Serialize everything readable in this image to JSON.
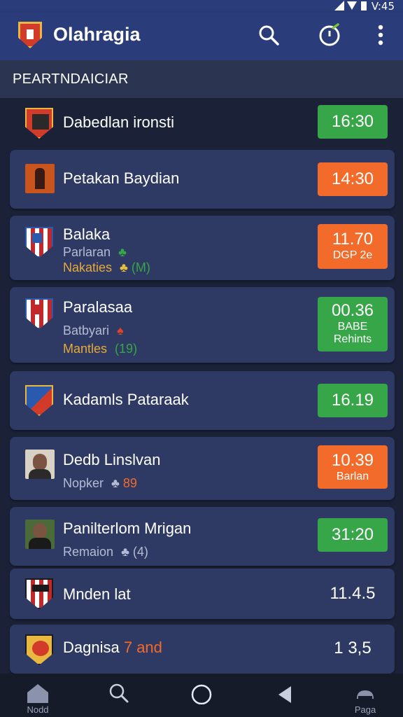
{
  "status_bar": {
    "time": "V:45"
  },
  "header": {
    "title": "Olahragia"
  },
  "section": {
    "title": "PEARTNDAICIAR"
  },
  "matches": [
    {
      "name": "Dabedlan ironsti",
      "score": "16:30",
      "score_color": "#36a648"
    },
    {
      "name": "Petakan Baydian",
      "score": "14:30",
      "score_color": "#f26b2a"
    },
    {
      "name": "Balaka",
      "sub": "Parlaran",
      "sub2": "Nakaties",
      "sub2_tag": "(M)",
      "score": "11.70",
      "score_label": "DGP 2e",
      "score_color": "#f26b2a"
    },
    {
      "name": "Paralasaa",
      "sub": "Batbyari",
      "sub2": "Mantles",
      "sub2_tag": "(19)",
      "score": "00.36",
      "score_label": "BABE",
      "score_label2": "Rehints",
      "score_color": "#36a648"
    },
    {
      "name": "Kadamls Pataraak",
      "score": "16.19",
      "score_color": "#36a648"
    },
    {
      "name": "Dedb Linslvan",
      "sub": "Nopker",
      "sub_tag": "89",
      "score": "10.39",
      "score_label": "Barlan",
      "score_color": "#f26b2a"
    },
    {
      "name": "Panilterlom Mrigan",
      "sub": "Remaion",
      "sub_tag": "(4)",
      "score": "31:20",
      "score_color": "#36a648"
    },
    {
      "name": "Mnden lat",
      "score": "11.4.5"
    },
    {
      "name": "Dagnisa",
      "name_accent": "7 and",
      "score": "1 3,5"
    }
  ],
  "bottom_nav": {
    "home_label": "Nodd",
    "profile_label": "Paga"
  },
  "colors": {
    "header_bg": "#2a3d7a",
    "card_bg": "#2e3a63",
    "green": "#36a648",
    "orange": "#f26b2a",
    "accent_text": "#e6a93a"
  }
}
